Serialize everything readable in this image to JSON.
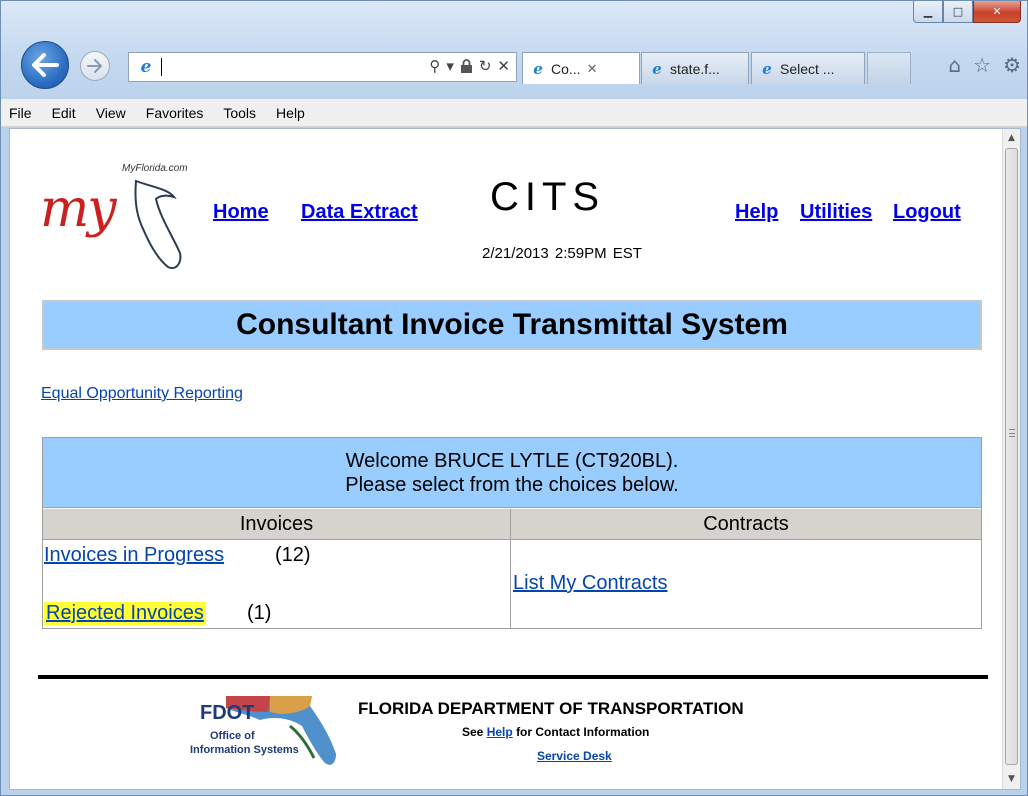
{
  "browser": {
    "window_controls": {
      "minimize": "▁",
      "maximize": "□",
      "close": "✕"
    },
    "address_value": "",
    "address_icons": [
      "search-icon",
      "dropdown-icon",
      "lock-icon",
      "refresh-icon",
      "stop-icon"
    ],
    "tabs": [
      {
        "label": "Co...",
        "active": true,
        "close": "✕"
      },
      {
        "label": "state.f...",
        "active": false
      },
      {
        "label": "Select ...",
        "active": false
      }
    ],
    "toolbar_icons": [
      "home-icon",
      "favorites-star-icon",
      "settings-gear-icon"
    ],
    "menu": [
      "File",
      "Edit",
      "View",
      "Favorites",
      "Tools",
      "Help"
    ]
  },
  "header": {
    "logo_site": "MyFlorida.com",
    "logo_text": "my",
    "nav_left": [
      "Home",
      "Data Extract"
    ],
    "app_title": "CITS",
    "datetime": "2/21/2013   2:59PM EST",
    "nav_right": [
      "Help",
      "Utilities",
      "Logout"
    ]
  },
  "banner_title": "Consultant Invoice Transmittal System",
  "equal_opportunity_link": "Equal Opportunity Reporting",
  "panel": {
    "welcome_line1": "Welcome BRUCE LYTLE (CT920BL).",
    "welcome_line2": "Please select from the choices below.",
    "invoices_header": "Invoices",
    "contracts_header": "Contracts",
    "invoices_in_progress_link": "Invoices in Progress",
    "invoices_in_progress_count": "(12)",
    "rejected_invoices_link": "Rejected Invoices",
    "rejected_invoices_count": "(1)",
    "list_contracts_link": "List My Contracts"
  },
  "footer": {
    "logo_fdot": "FDOT",
    "logo_line1": "Office of",
    "logo_line2": "Information Systems",
    "department": "FLORIDA DEPARTMENT OF TRANSPORTATION",
    "see_prefix": "See",
    "help_link": "Help",
    "see_suffix": "for Contact Information",
    "service_desk_link": "Service Desk"
  },
  "colors": {
    "banner_bg": "#99ccff",
    "header_row_bg": "#d6d3ce",
    "highlight": "#ffff33",
    "link": "#0645ad"
  }
}
